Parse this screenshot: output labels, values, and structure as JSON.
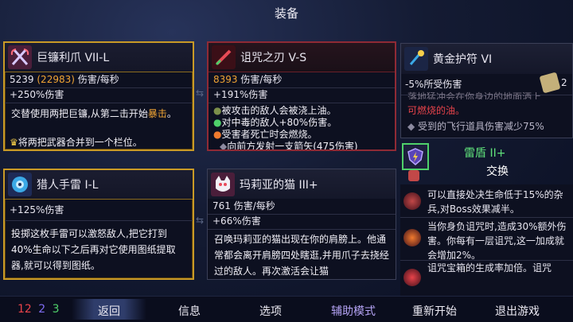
{
  "title": "装备",
  "cards": {
    "scythe": {
      "name": "巨镰利爪 VII-L",
      "dps_value": "5239",
      "dps_paren": "(22983)",
      "dps_unit": "伤害/每秒",
      "bonus": "+250%伤害",
      "desc_main": "交替使用两把巨镰,从第二击开始",
      "desc_highlight": "暴击",
      "desc_end": "。",
      "merge_note": "将两把武器合并到一个栏位。"
    },
    "curse_blade": {
      "name": "诅咒之刃 V-S",
      "dps_value": "8393",
      "dps_unit": "伤害/每秒",
      "bonus": "+191%伤害",
      "effects": [
        "被攻击的敌人会被浇上油。",
        "对中毒的敌人+80%伤害。",
        "受害者死亡时会燃烧。",
        "向前方发射一支箭矢(475伤害)"
      ]
    },
    "grenade": {
      "name": "猎人手雷 I-L",
      "bonus": "+125%伤害",
      "desc": "投掷这枚手雷可以激怒敌人,把它打到40%生命以下之后再对它使用图纸提取器,就可以得到图纸。"
    },
    "cat": {
      "name": "玛莉亚的猫 III+",
      "dps_value": "761",
      "dps_unit": "伤害/每秒",
      "bonus": "+66%伤害",
      "desc": "召唤玛莉亚的猫出现在你的肩膀上。他通常都会离开肩膀四处瞎逛,并用爪子去挠经过的敌人。再次激活会让猫"
    }
  },
  "right_panel": {
    "amulet": {
      "name": "黄金护符 VI",
      "stat": "-5%所受伤害",
      "scroll_count": "2",
      "effect_partial_top": "落地猛冲会在你身边的地面洒上",
      "effect_oil": "可燃烧的油。",
      "effect_projectile": "受到的飞行道具伤害减少75%"
    },
    "shield": {
      "name": "雷盾 II+",
      "action": "交换"
    },
    "mutations": [
      "可以直接处决生命低于15%的杂兵,对Boss效果减半。",
      "当你身负诅咒时,造成30%额外伤害。你每有一层诅咒,这一加成就会增加2%。",
      "诅咒宝箱的生成率加倍。诅咒"
    ]
  },
  "bottom_bar": {
    "stats": {
      "brutality": "12",
      "tactics": "2",
      "survival": "3"
    },
    "nav": [
      "返回",
      "信息",
      "选项",
      "辅助模式",
      "重新开始",
      "退出游戏"
    ]
  },
  "colors": {
    "brutality": "#e8434a",
    "tactics": "#7e6cf2",
    "survival": "#4fd06a",
    "gold_border": "#c99a26",
    "red_border": "#8f2a35",
    "assist_mode": "#b5a4f5"
  }
}
